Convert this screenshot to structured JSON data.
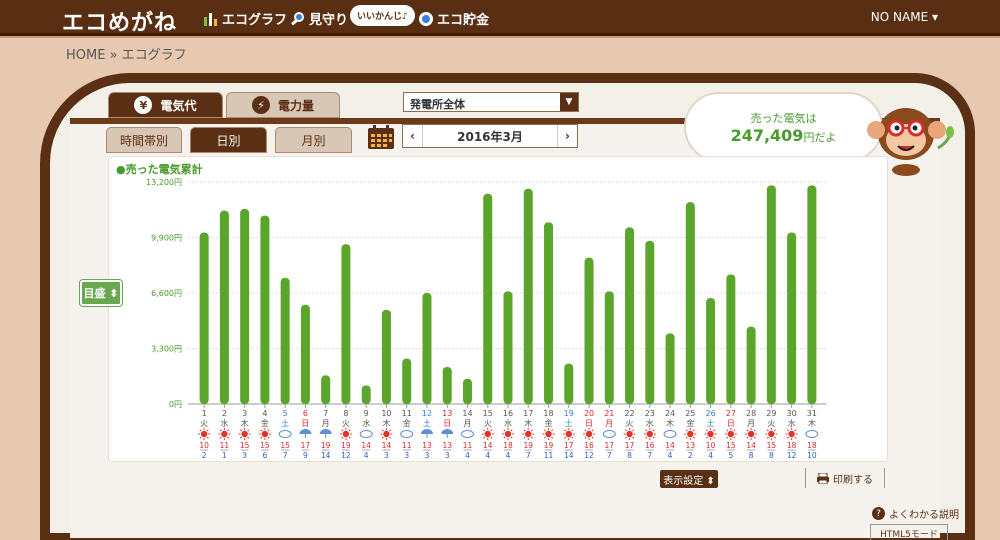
{
  "app": {
    "title": "エコめがね"
  },
  "nav": {
    "graph": "エコグラフ",
    "watch": "見守り",
    "watch_tag": "いいかんじ♪",
    "savings": "エコ貯金"
  },
  "user": {
    "name": "NO NAME ▾"
  },
  "breadcrumb": "HOME » エコグラフ",
  "tabs": {
    "cost": "電気代",
    "power": "電力量",
    "cost_icon": "¥",
    "power_icon": "⚡"
  },
  "plant_select": {
    "value": "発電所全体"
  },
  "subtabs": {
    "hourly": "時間帯別",
    "daily": "日別",
    "monthly": "月別"
  },
  "month_nav": {
    "label": "2016年3月",
    "prev": "‹",
    "next": "›"
  },
  "sold": {
    "label": "売った電気は",
    "amount": "247,409",
    "unit": "円だよ"
  },
  "scale_button": "目盛 ⬍",
  "display_settings": "表示設定 ⬍",
  "print": "印刷する",
  "help": "よくわかる説明",
  "html5_mode": "HTML5モード",
  "colors": {
    "bar": "#5ca52c",
    "brown": "#5b2f14",
    "sat": "#3b7fd9",
    "sun": "#d92b2b"
  },
  "chart_data": {
    "type": "bar",
    "title": "",
    "legend": "●売った電気累計",
    "ylim": [
      0,
      13200
    ],
    "yticks": [
      "13,200円",
      "9,900円",
      "6,600円",
      "3,300円",
      "0円"
    ],
    "yvalues": [
      13200,
      9900,
      6600,
      3300,
      0
    ],
    "days": [
      "1",
      "2",
      "3",
      "4",
      "5",
      "6",
      "7",
      "8",
      "9",
      "10",
      "11",
      "12",
      "13",
      "14",
      "15",
      "16",
      "17",
      "18",
      "19",
      "20",
      "21",
      "22",
      "23",
      "24",
      "25",
      "26",
      "27",
      "28",
      "29",
      "30",
      "31"
    ],
    "weekdays": [
      "火",
      "水",
      "木",
      "金",
      "土",
      "日",
      "月",
      "火",
      "水",
      "木",
      "金",
      "土",
      "日",
      "月",
      "火",
      "水",
      "木",
      "金",
      "土",
      "日",
      "月",
      "火",
      "水",
      "木",
      "金",
      "土",
      "日",
      "月",
      "火",
      "水",
      "木"
    ],
    "day_colors": [
      "n",
      "n",
      "n",
      "n",
      "sat",
      "sun",
      "n",
      "n",
      "n",
      "n",
      "n",
      "sat",
      "sun",
      "n",
      "n",
      "n",
      "n",
      "n",
      "sat",
      "sun",
      "sun",
      "n",
      "n",
      "n",
      "n",
      "sat",
      "sun",
      "n",
      "n",
      "n",
      "n"
    ],
    "weather": [
      "sun",
      "sun",
      "sun",
      "sun",
      "cloud",
      "rain",
      "rain",
      "sun",
      "cloud",
      "sun",
      "cloud",
      "rain",
      "rain",
      "cloud",
      "sun",
      "sun",
      "sun",
      "sun",
      "sun",
      "sun",
      "cloud",
      "sun",
      "sun",
      "cloud",
      "sun",
      "sun",
      "sun",
      "sun",
      "sun",
      "sun",
      "cloud"
    ],
    "high": [
      "10",
      "11",
      "15",
      "15",
      "15",
      "17",
      "19",
      "19",
      "14",
      "14",
      "11",
      "13",
      "13",
      "11",
      "14",
      "18",
      "19",
      "19",
      "17",
      "16",
      "17",
      "17",
      "16",
      "14",
      "13",
      "10",
      "15",
      "14",
      "15",
      "18",
      "18"
    ],
    "low": [
      "2",
      "1",
      "3",
      "6",
      "7",
      "9",
      "14",
      "12",
      "4",
      "3",
      "3",
      "3",
      "3",
      "4",
      "4",
      "4",
      "7",
      "11",
      "14",
      "12",
      "7",
      "8",
      "7",
      "4",
      "2",
      "4",
      "5",
      "8",
      "8",
      "12",
      "10"
    ],
    "values": [
      10200,
      11500,
      11600,
      11200,
      7500,
      5900,
      1700,
      9500,
      1100,
      5600,
      2700,
      6600,
      2200,
      1500,
      12500,
      6700,
      12800,
      10800,
      2400,
      8700,
      6700,
      10500,
      9700,
      4200,
      12000,
      6300,
      7700,
      4600,
      13000,
      10200,
      13000
    ]
  }
}
